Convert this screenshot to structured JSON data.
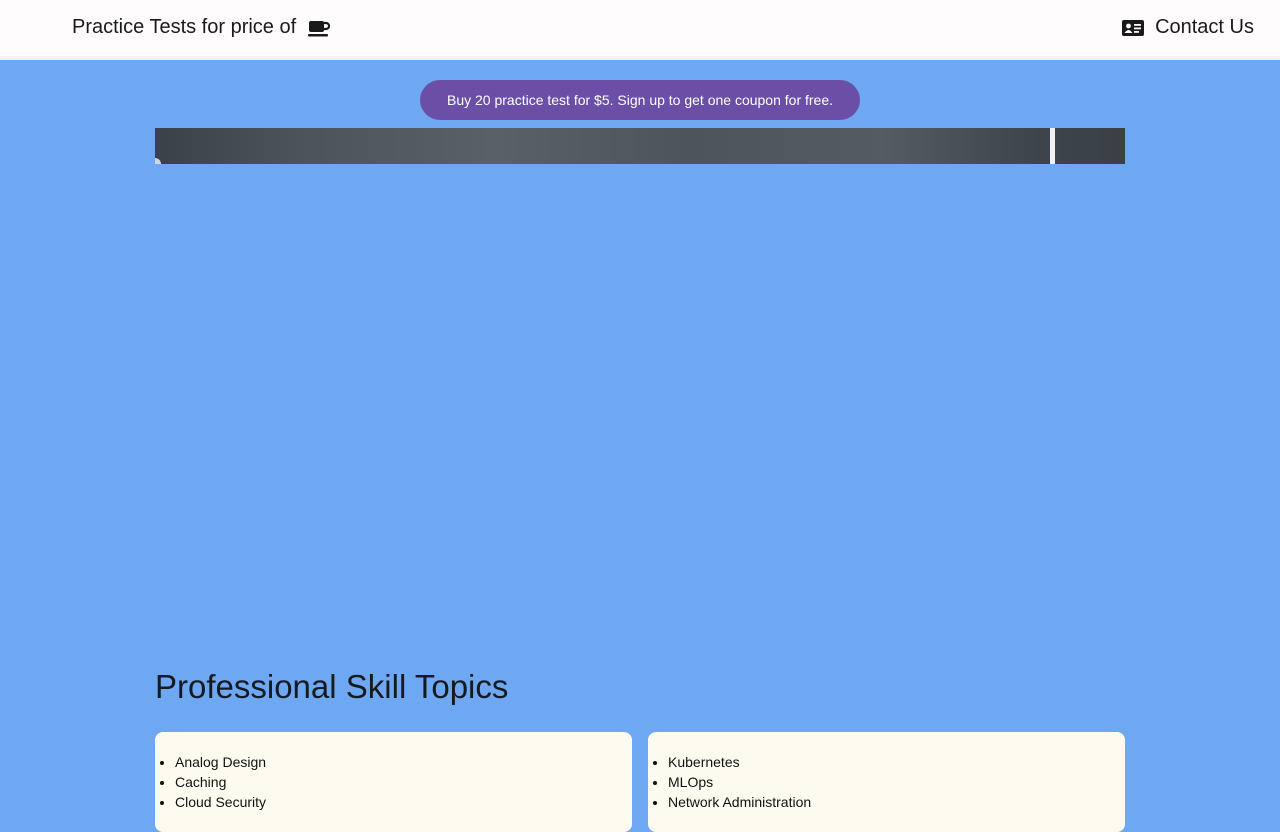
{
  "navbar": {
    "brand_text": "Practice Tests for price of",
    "brand_icon": "coffee-cup-icon",
    "contact_text": "Contact Us",
    "contact_icon": "address-card-icon"
  },
  "promo": {
    "text": "Buy 20 practice test for $5. Sign up to get one coupon for free."
  },
  "topics": {
    "title": "Professional Skill Topics",
    "left_items": [
      "Analog Design",
      "Caching",
      "Cloud Security"
    ],
    "right_items": [
      "Kubernetes",
      "MLOps",
      "Network Administration"
    ]
  },
  "colors": {
    "background": "#6fa8f2",
    "navbar": "#fffcfe",
    "promo": "#6b4fa7",
    "card": "#fdfbef"
  }
}
